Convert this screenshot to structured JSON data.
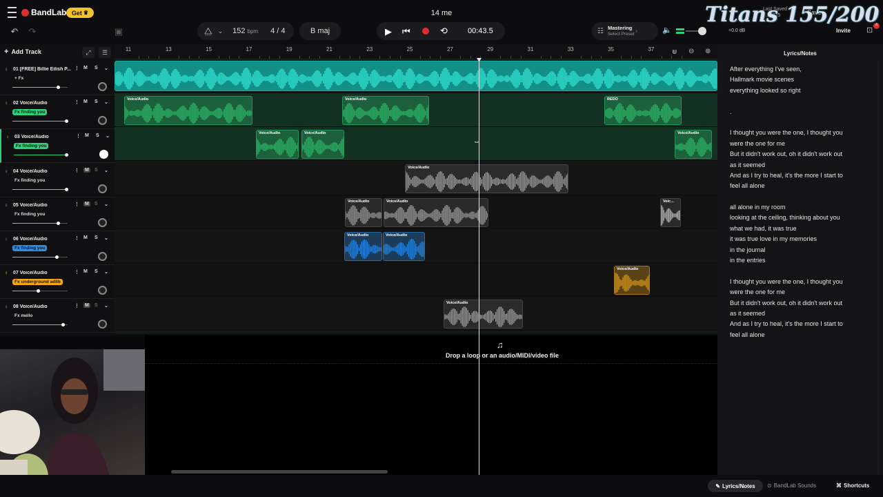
{
  "app": {
    "menu_icon": "hamburger-icon",
    "logo_icon": "bandlab-logo-icon",
    "brand": "BandLab",
    "get_button": "Get",
    "project_title": "14 me",
    "last_saved": "Last Saved",
    "last_saved_time": "... 2025",
    "save_label": "Save",
    "invite_label": "Invite",
    "notification_count": "4",
    "accent": "#e02d2d"
  },
  "watermark": {
    "text": "Titans 155/200"
  },
  "transport": {
    "bpm": "152",
    "bpm_unit": "bpm",
    "time_signature_num": "4",
    "time_signature_den": "4",
    "key": "B maj",
    "time": "00:43.5"
  },
  "mastering": {
    "title": "Mastering",
    "subtitle": "Select Preset"
  },
  "master_volume": {
    "db_label": "+0.0 dB"
  },
  "tracks_panel": {
    "add_track_label": "Add Track"
  },
  "ruler": {
    "ticks": [
      "11",
      "13",
      "15",
      "17",
      "19",
      "21",
      "23",
      "25",
      "27",
      "29",
      "31",
      "33",
      "35",
      "37"
    ]
  },
  "tracks": [
    {
      "name": "01  [FREE] Billie Eilish P...",
      "fx": "+ Fx",
      "fx_tag": false,
      "color": "#22d3c5",
      "volume": 0.82
    },
    {
      "name": "02  Voice/Audio",
      "fx": "Fx finding you",
      "fx_tag": true,
      "color": "#2fd07a",
      "volume": 0.97
    },
    {
      "name": "03  Voice/Audio",
      "fx": "Fx finding you",
      "fx_tag": true,
      "color": "#2fd07a",
      "volume": 0.95
    },
    {
      "name": "04  Voice/Audio",
      "fx": "Fx finding you",
      "fx_tag": false,
      "color": "#888888",
      "volume": 0.97
    },
    {
      "name": "05  Voice/Audio",
      "fx": "Fx finding you",
      "fx_tag": false,
      "color": "#888888",
      "volume": 0.83
    },
    {
      "name": "06  Voice/Audio",
      "fx": "Fx finding you",
      "fx_tag": true,
      "color": "#2d8ee8",
      "volume": 0.8
    },
    {
      "name": "07  Voice/Audio",
      "fx": "Fx underground adlib",
      "fx_tag": true,
      "color": "#f0a81c",
      "volume": 0.46
    },
    {
      "name": "08  Voice/Audio",
      "fx": "Fx mello",
      "fx_tag": false,
      "color": "#888888",
      "volume": 0.91
    }
  ],
  "clip_labels": {
    "voice": "Voice/Audio",
    "redo": "REDO",
    "voice_short": "Voic..."
  },
  "drop_zone": {
    "icon": "music-note-add-icon",
    "text": "Drop a loop or an audio/MIDI/video file"
  },
  "notes_panel": {
    "title": "Lyrics/Notes",
    "lines": [
      "After everything I've seen,",
      "Hallmark movie scenes",
      "everything looked so right",
      "",
      ".",
      "",
      "I thought you were the one, I thought you",
      "were the one for me",
      "But it didn't work out, oh it didn't work out",
      "as it seemed",
      "And as I try to heal, it's the more I start to",
      "feel all alone",
      "",
      "all alone in my room",
      "looking at the ceiling, thinking about you",
      "what we had, it was true",
      "it was true love in my memories",
      "in the journal",
      "in the entries",
      "",
      "I thought you were the one, I thought you",
      "were the one for me",
      "But it didn't work out, oh it didn't work out",
      "as it seemed",
      "And as I try to heal, it's the more I start to",
      "feel all alone"
    ]
  },
  "bottom": {
    "lyrics_tab": "Lyrics/Notes",
    "sounds_tab": "BandLab Sounds",
    "shortcuts": "Shortcuts"
  }
}
